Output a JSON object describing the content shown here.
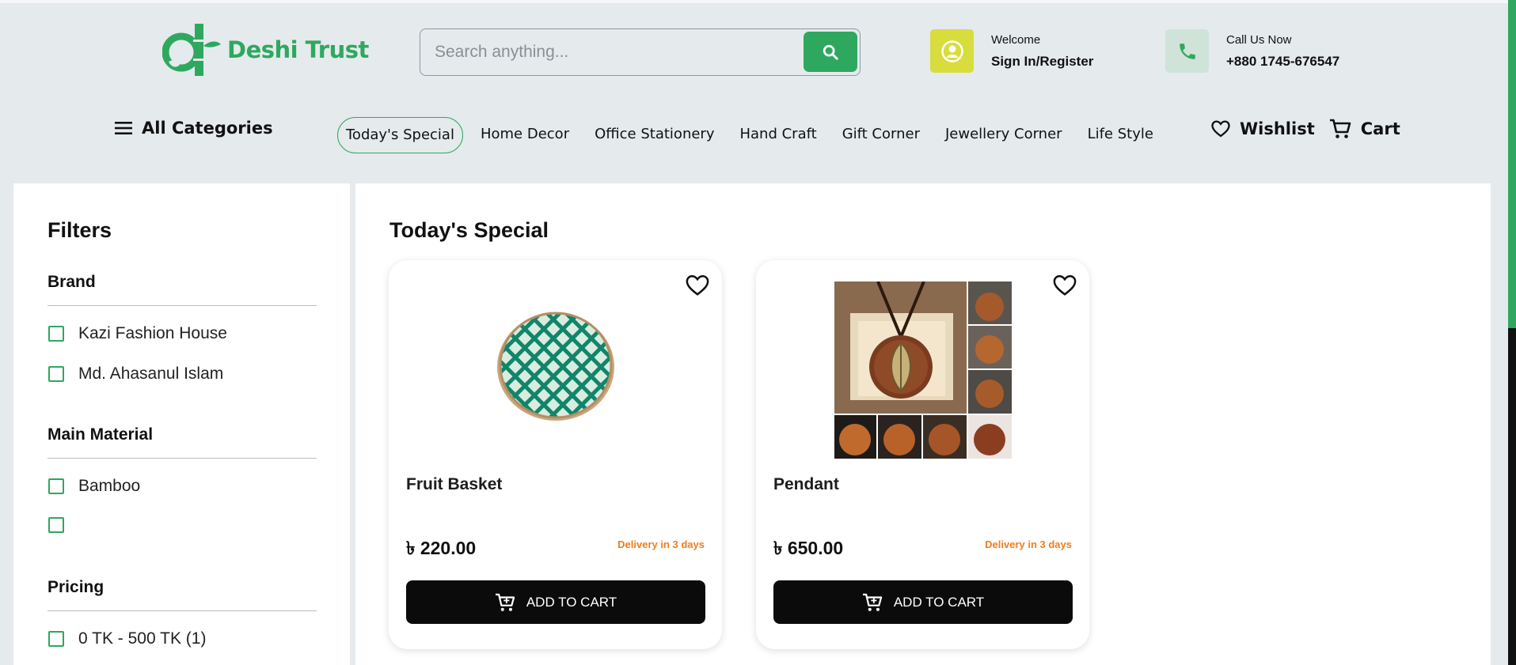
{
  "header": {
    "brand": "Deshi Trust",
    "search_placeholder": "Search anything...",
    "welcome_label": "Welcome",
    "signin_label": "Sign In/Register",
    "call_label": "Call Us Now",
    "phone": "+880 1745-676547",
    "colors": {
      "brand": "#2fa85f",
      "user_tile": "#d8dc3c",
      "phone_tile": "#cfe3d8"
    }
  },
  "nav": {
    "all_categories": "All Categories",
    "links": [
      "Today's Special",
      "Home Decor",
      "Office Stationery",
      "Hand Craft",
      "Gift Corner",
      "Jewellery Corner",
      "Life Style"
    ],
    "active": "Today's Special",
    "wishlist": "Wishlist",
    "cart": "Cart"
  },
  "filters": {
    "title": "Filters",
    "brand": {
      "title": "Brand",
      "options": [
        "Kazi Fashion House",
        "Md. Ahasanul Islam"
      ]
    },
    "material": {
      "title": "Main Material",
      "options": [
        "Bamboo",
        ""
      ]
    },
    "pricing": {
      "title": "Pricing",
      "options": [
        "0 TK - 500 TK (1)"
      ]
    }
  },
  "main": {
    "title": "Today's Special",
    "products": [
      {
        "name": "Fruit Basket",
        "price": "৳ 220.00",
        "delivery": "Delivery in 3 days",
        "button": "ADD TO CART",
        "image": "bamboo-basket"
      },
      {
        "name": "Pendant",
        "price": "৳ 650.00",
        "delivery": "Delivery in 3 days",
        "button": "ADD TO CART",
        "image": "leaf-pendant"
      }
    ]
  }
}
